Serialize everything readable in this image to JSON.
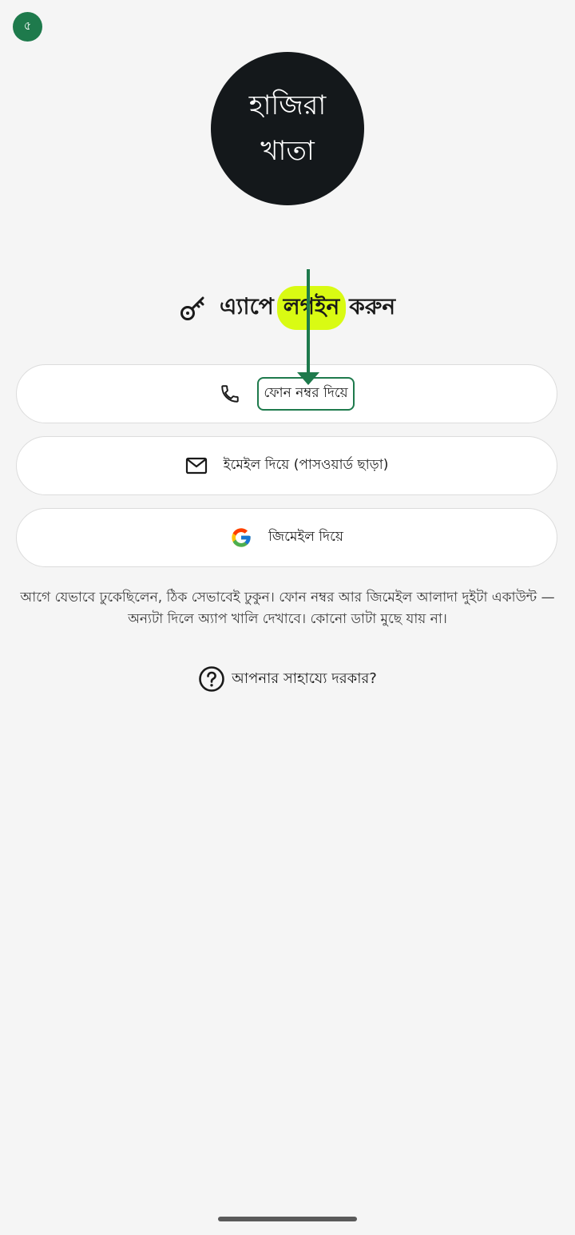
{
  "step_badge": "৫",
  "logo": {
    "line1": "হাজিরা",
    "line2": "খাতা"
  },
  "title": {
    "part1": "এ্যাপে",
    "highlight": "লগইন",
    "part2": "করুন",
    "highlight_color": "#d9fb13"
  },
  "buttons": {
    "phone": {
      "label": "ফোন নম্বর দিয়ে",
      "icon": "phone-icon"
    },
    "email": {
      "label": "ইমেইল দিয়ে (পাসওয়ার্ড ছাড়া)",
      "icon": "mail-icon"
    },
    "google": {
      "label": "জিমেইল দিয়ে",
      "icon": "google-icon"
    }
  },
  "note": "আগে যেভাবে ঢুকেছিলেন, ঠিক সেভাবেই ঢুকুন। ফোন নম্বর আর জিমেইল আলাদা দুইটা একাউন্ট — অন্যটা দিলে অ্যাপ খালি দেখাবে। কোনো ডাটা মুছে যায় না।",
  "help": {
    "label": "আপনার সাহায্যে দরকার?",
    "icon": "help-circle-icon"
  },
  "colors": {
    "accent_green": "#1e7a4c",
    "logo_bg": "#14181b",
    "background": "#f5f5f5"
  }
}
